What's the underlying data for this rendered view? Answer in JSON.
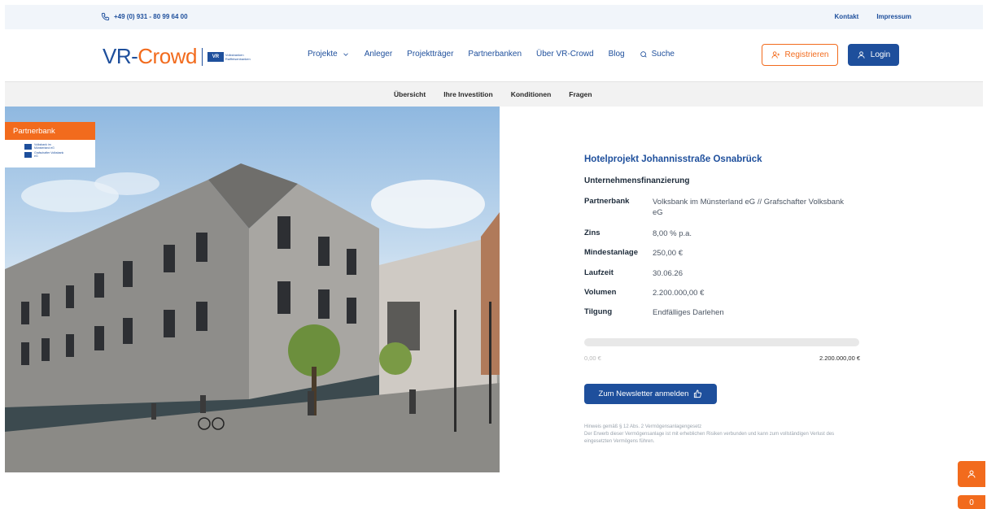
{
  "topbar": {
    "phone": "+49 (0) 931 - 80 99 64 00",
    "links": [
      "Kontakt",
      "Impressum"
    ]
  },
  "logo": {
    "brand_vr": "VR-",
    "brand_crowd": "Crowd",
    "vr_box": "VR",
    "vr_text": "Volksbanken Raiffeisenbanken"
  },
  "nav": {
    "items": [
      "Projekte",
      "Anleger",
      "Projektträger",
      "Partnerbanken",
      "Über VR-Crowd",
      "Blog",
      "Suche"
    ]
  },
  "buttons": {
    "register": "Registrieren",
    "login": "Login",
    "newsletter": "Zum Newsletter anmelden"
  },
  "subnav": {
    "tabs": [
      "Übersicht",
      "Ihre Investition",
      "Konditionen",
      "Fragen"
    ]
  },
  "partner_badge": {
    "label": "Partnerbank",
    "banks": [
      "Volksbank im Münsterland eG",
      "Grafschafter Volksbank eG"
    ]
  },
  "project": {
    "title": "Hotelprojekt Johannisstraße Osnabrück",
    "subtitle": "Unternehmensfinanzierung",
    "details": [
      {
        "key": "Partnerbank",
        "value": "Volksbank im Münsterland eG // Grafschafter Volksbank eG"
      },
      {
        "key": "Zins",
        "value": "8,00 % p.a."
      },
      {
        "key": "Mindestanlage",
        "value": "250,00 €"
      },
      {
        "key": "Laufzeit",
        "value": "30.06.26"
      },
      {
        "key": "Volumen",
        "value": "2.200.000,00 €"
      },
      {
        "key": "Tilgung",
        "value": "Endfälliges Darlehen"
      }
    ],
    "progress_min": "0,00 €",
    "progress_max": "2.200.000,00 €",
    "progress_fraction": 0,
    "disclaimer_title": "Hinweis gemäß § 12 Abs. 2 Vermögensanlagengesetz",
    "disclaimer_text": "Der Erwerb dieser Vermögensanlage ist mit erheblichen Risiken verbunden und kann zum vollständigen Verlust des eingesetzten Vermögens führen."
  },
  "fab": {
    "second_label": "0"
  },
  "colors": {
    "primary": "#1e4f9c",
    "accent": "#f26b1d"
  }
}
